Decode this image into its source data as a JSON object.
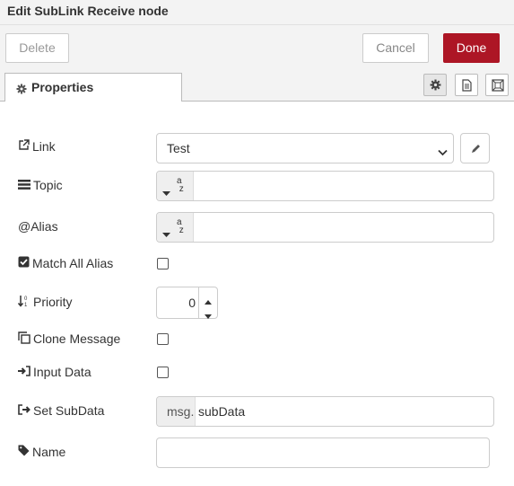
{
  "dialog": {
    "title": "Edit SubLink Receive node"
  },
  "toolbar": {
    "delete_label": "Delete",
    "cancel_label": "Cancel",
    "done_label": "Done",
    "accent": "#ad1625"
  },
  "tabs": {
    "properties_label": "Properties"
  },
  "tray_icons": [
    "gear-icon",
    "document-icon",
    "frame-icon"
  ],
  "form": {
    "link": {
      "label": "Link",
      "value": "Test",
      "icon": "external-link-icon"
    },
    "topic": {
      "label": "Topic",
      "value": "",
      "type_icon": "string-az-icon"
    },
    "alias": {
      "label": "Alias",
      "prefix": "@",
      "value": "",
      "type_icon": "string-az-icon"
    },
    "match_all_alias": {
      "label": "Match All Alias",
      "checked": false
    },
    "priority": {
      "label": "Priority",
      "value": "0"
    },
    "clone_message": {
      "label": "Clone Message",
      "checked": false
    },
    "input_data": {
      "label": "Input Data",
      "checked": false
    },
    "set_subdata": {
      "label": "Set SubData",
      "prefix": "msg.",
      "value": "subData"
    },
    "name": {
      "label": "Name",
      "value": ""
    }
  }
}
